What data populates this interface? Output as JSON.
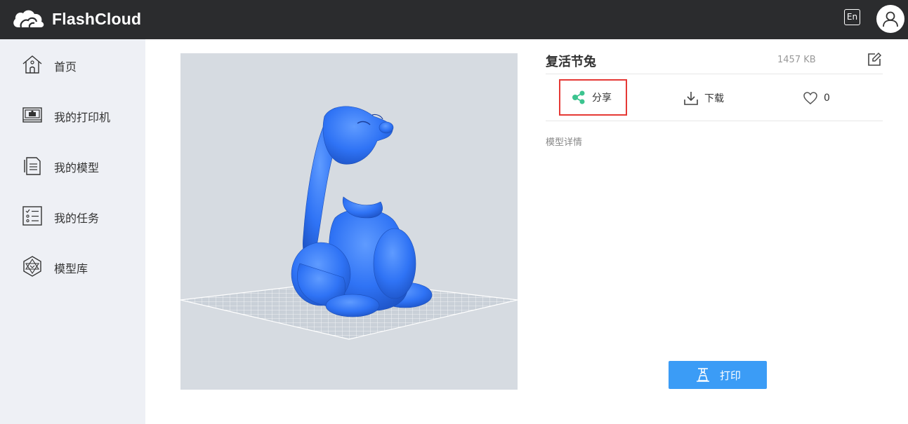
{
  "header": {
    "app_name": "FlashCloud",
    "language_label": "En",
    "logo_icon": "cloud-logo-icon",
    "avatar_icon": "user-icon"
  },
  "sidebar": {
    "items": [
      {
        "label": "首页",
        "icon": "home-icon"
      },
      {
        "label": "我的打印机",
        "icon": "printer-icon"
      },
      {
        "label": "我的模型",
        "icon": "document-icon"
      },
      {
        "label": "我的任务",
        "icon": "task-list-icon"
      },
      {
        "label": "模型库",
        "icon": "model-library-icon"
      }
    ]
  },
  "model": {
    "title": "复活节兔",
    "size": "1457 KB",
    "model_color": "#2f73f5",
    "details_label": "模型详情"
  },
  "actions": {
    "share_label": "分享",
    "download_label": "下载",
    "like_count": "0",
    "share_icon_color": "#3cc48f"
  },
  "print_button": {
    "label": "打印",
    "color": "#3b9cf6"
  },
  "highlight_color": "#e53935"
}
